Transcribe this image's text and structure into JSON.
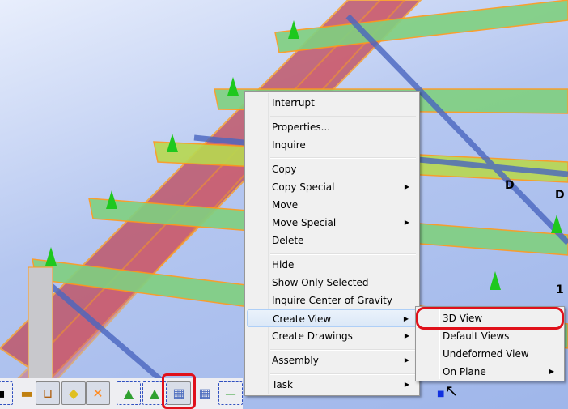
{
  "context_menu": {
    "items": [
      {
        "label": "Interrupt"
      },
      {
        "label": "Properties..."
      },
      {
        "label": "Inquire"
      },
      {
        "label": "Copy"
      },
      {
        "label": "Copy Special",
        "submenu": true
      },
      {
        "label": "Move"
      },
      {
        "label": "Move Special",
        "submenu": true
      },
      {
        "label": "Delete"
      },
      {
        "label": "Hide"
      },
      {
        "label": "Show Only Selected"
      },
      {
        "label": "Inquire Center of Gravity"
      },
      {
        "label": "Create View",
        "submenu": true,
        "highlighted": true
      },
      {
        "label": "Create Drawings",
        "submenu": true
      },
      {
        "label": "Assembly",
        "submenu": true
      },
      {
        "label": "Task",
        "submenu": true
      }
    ]
  },
  "submenu": {
    "items": [
      {
        "label": "3D View",
        "circled": true
      },
      {
        "label": "Default Views"
      },
      {
        "label": "Undeformed View"
      },
      {
        "label": "On Plane",
        "submenu": true
      }
    ]
  },
  "model_labels": {
    "grid_d1": "D",
    "grid_d2": "D",
    "grid_1": "1"
  },
  "toolbar": {
    "icons": [
      "bolt-icon",
      "bolt-part-icon",
      "weld-icon",
      "plate-icon",
      "cut-icon",
      "phase-down-icon",
      "phase-up-icon",
      "grid-down-icon",
      "grid-up-icon",
      "clock-icon"
    ],
    "selected": "grid-down-icon"
  },
  "colors": {
    "highlight_red": "#e0101a",
    "beam_green": "#7fd07f",
    "column_red": "#b84050",
    "brace_blue": "#5a78c8",
    "outline_orange": "#ff9a1a"
  }
}
